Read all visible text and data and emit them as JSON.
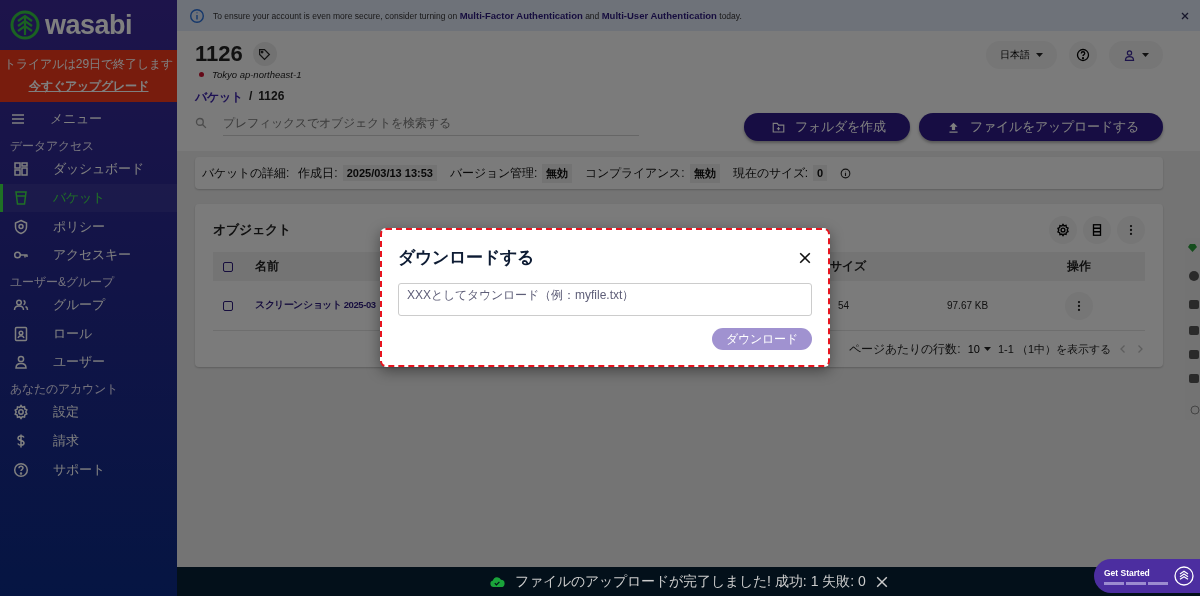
{
  "brand": {
    "name": "wasabi"
  },
  "trial": {
    "message": "トライアルは29日で終了します",
    "link": "今すぐアップグレード"
  },
  "sidebar": {
    "menu_label": "メニュー",
    "sections": [
      {
        "heading": "データアクセス",
        "items": [
          {
            "label": "ダッシュボード",
            "selected": false
          },
          {
            "label": "バケット",
            "selected": true
          },
          {
            "label": "ポリシー",
            "selected": false
          },
          {
            "label": "アクセスキー",
            "selected": false
          }
        ]
      },
      {
        "heading": "ユーザー&グループ",
        "items": [
          {
            "label": "グループ",
            "selected": false
          },
          {
            "label": "ロール",
            "selected": false
          },
          {
            "label": "ユーザー",
            "selected": false
          }
        ]
      },
      {
        "heading": "あなたのアカウント",
        "items": [
          {
            "label": "設定",
            "selected": false
          },
          {
            "label": "請求",
            "selected": false
          },
          {
            "label": "サポート",
            "selected": false
          }
        ]
      }
    ]
  },
  "banner": {
    "before": "To ensure your account is even more secure, consider turning on ",
    "link_1": "Multi-Factor Authentication",
    "middle": " and ",
    "link_2": "Multi-User Authentication",
    "after": " today."
  },
  "header": {
    "title": "1126",
    "region": "Tokyo ap-northeast-1",
    "breadcrumb": [
      "バケット",
      "1126"
    ],
    "breadcrumb_separator": "/",
    "search_placeholder": "プレフィックスでオブジェクトを検索する",
    "language": "日本語",
    "actions": [
      "フォルダを作成",
      "ファイルをアップロードする"
    ]
  },
  "details": {
    "label": "バケットの詳細:",
    "fields": [
      {
        "label": "作成日:",
        "value": "2025/03/13 13:53"
      },
      {
        "label": "バージョン管理:",
        "value": "無効"
      },
      {
        "label": "コンプライアンス:",
        "value": "無効"
      },
      {
        "label": "現在のサイズ:",
        "value": "0"
      }
    ]
  },
  "objects": {
    "title": "オブジェクト",
    "columns": [
      "名前",
      "サイズ",
      "操作"
    ],
    "select_all_checked": false,
    "rows": [
      {
        "checked": false,
        "name": "スクリーンショット 2025-03",
        "column_3": "54",
        "size": "97.67 KB"
      }
    ],
    "pagination": {
      "rows_label": "ページあたりの行数:",
      "rows_per_page": "10",
      "range": "1-1 （1中）を表示する"
    }
  },
  "dialog": {
    "title": "ダウンロードする",
    "placeholder": "XXXとしてタウンロード（例：myfile.txt）",
    "button": "ダウンロード",
    "button_disabled": true
  },
  "toast": {
    "message": "ファイルのアップロードが完了しました! 成功: 1 失敗: 0"
  },
  "get_started": {
    "label": "Get Started"
  }
}
